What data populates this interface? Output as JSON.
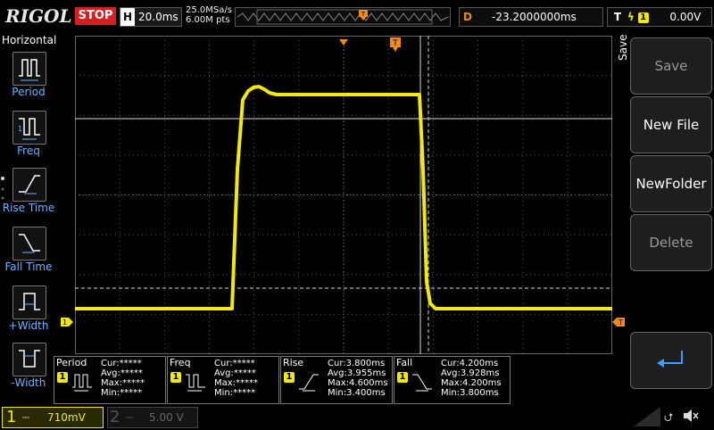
{
  "brand": "RIGOL",
  "run_status": "STOP",
  "horizontal": {
    "key": "H",
    "timebase": "20.0ms"
  },
  "acquisition": {
    "sample_rate": "25.0MSa/s",
    "memory_depth": "6.00M pts"
  },
  "delay": {
    "key": "D",
    "value": "-23.2000000ms"
  },
  "trigger": {
    "key": "T",
    "channel": "1",
    "level": "0.00V"
  },
  "left_menu": {
    "title": "Horizontal",
    "items": [
      {
        "label": "Period",
        "icon": "period-icon"
      },
      {
        "label": "Freq",
        "icon": "freq-icon"
      },
      {
        "label": "Rise Time",
        "icon": "rise-time-icon"
      },
      {
        "label": "Fall Time",
        "icon": "fall-time-icon"
      },
      {
        "label": "+Width",
        "icon": "positive-width-icon"
      },
      {
        "label": "-Width",
        "icon": "negative-width-icon"
      }
    ]
  },
  "right_menu": {
    "side_label": "Save",
    "buttons": [
      {
        "label": "Save",
        "enabled": false
      },
      {
        "label": "New File",
        "enabled": true
      },
      {
        "label": "NewFolder",
        "enabled": true
      },
      {
        "label": "Delete",
        "enabled": false
      },
      {
        "label": "",
        "icon": "enter-icon",
        "enabled": true
      }
    ]
  },
  "measurements": [
    {
      "name": "Period",
      "channel": "1",
      "cur": "Cur:*****",
      "avg": "Avg:*****",
      "max": "Max:*****",
      "min": "Min:*****"
    },
    {
      "name": "Freq",
      "channel": "1",
      "cur": "Cur:*****",
      "avg": "Avg:*****",
      "max": "Max:*****",
      "min": "Min:*****"
    },
    {
      "name": "Rise",
      "channel": "1",
      "cur": "Cur:3.800ms",
      "avg": "Avg:3.955ms",
      "max": "Max:4.600ms",
      "min": "Min:3.400ms"
    },
    {
      "name": "Fall",
      "channel": "1",
      "cur": "Cur:4.200ms",
      "avg": "Avg:3.928ms",
      "max": "Max:4.200ms",
      "min": "Min:3.800ms"
    }
  ],
  "channels": [
    {
      "number": "1",
      "scale": "710mV",
      "active": true
    },
    {
      "number": "2",
      "scale": "5.00 V",
      "active": false
    }
  ],
  "colors": {
    "ch1": "#f2ea00",
    "trigger": "#f08b17",
    "stop": "#d81e1e",
    "menu_label": "#6fb3ff"
  }
}
